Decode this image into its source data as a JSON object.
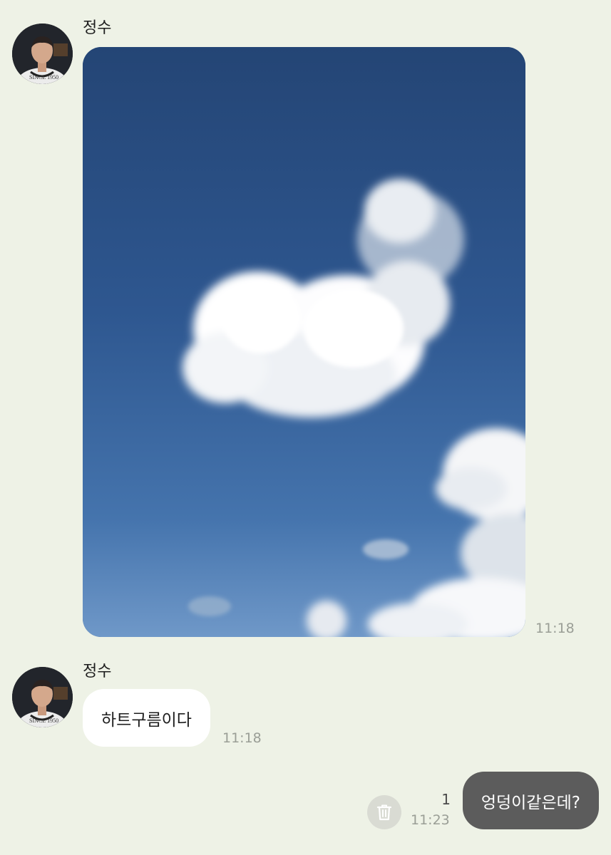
{
  "messages": [
    {
      "sender": "정수",
      "type": "photo",
      "time": "11:18"
    },
    {
      "sender": "정수",
      "type": "text",
      "text": "하트구름이다",
      "time": "11:18"
    },
    {
      "sender": "me",
      "type": "text",
      "text": "엉덩이같은데?",
      "time": "11:23",
      "unread_count": "1"
    }
  ],
  "avatar_shirt_text": "SINCE 1950",
  "icons": {
    "delete": "trash-icon"
  },
  "colors": {
    "background": "#eef2e6",
    "incoming_bubble": "#ffffff",
    "outgoing_bubble": "#5c5c5c",
    "sky": "#2c5288"
  }
}
